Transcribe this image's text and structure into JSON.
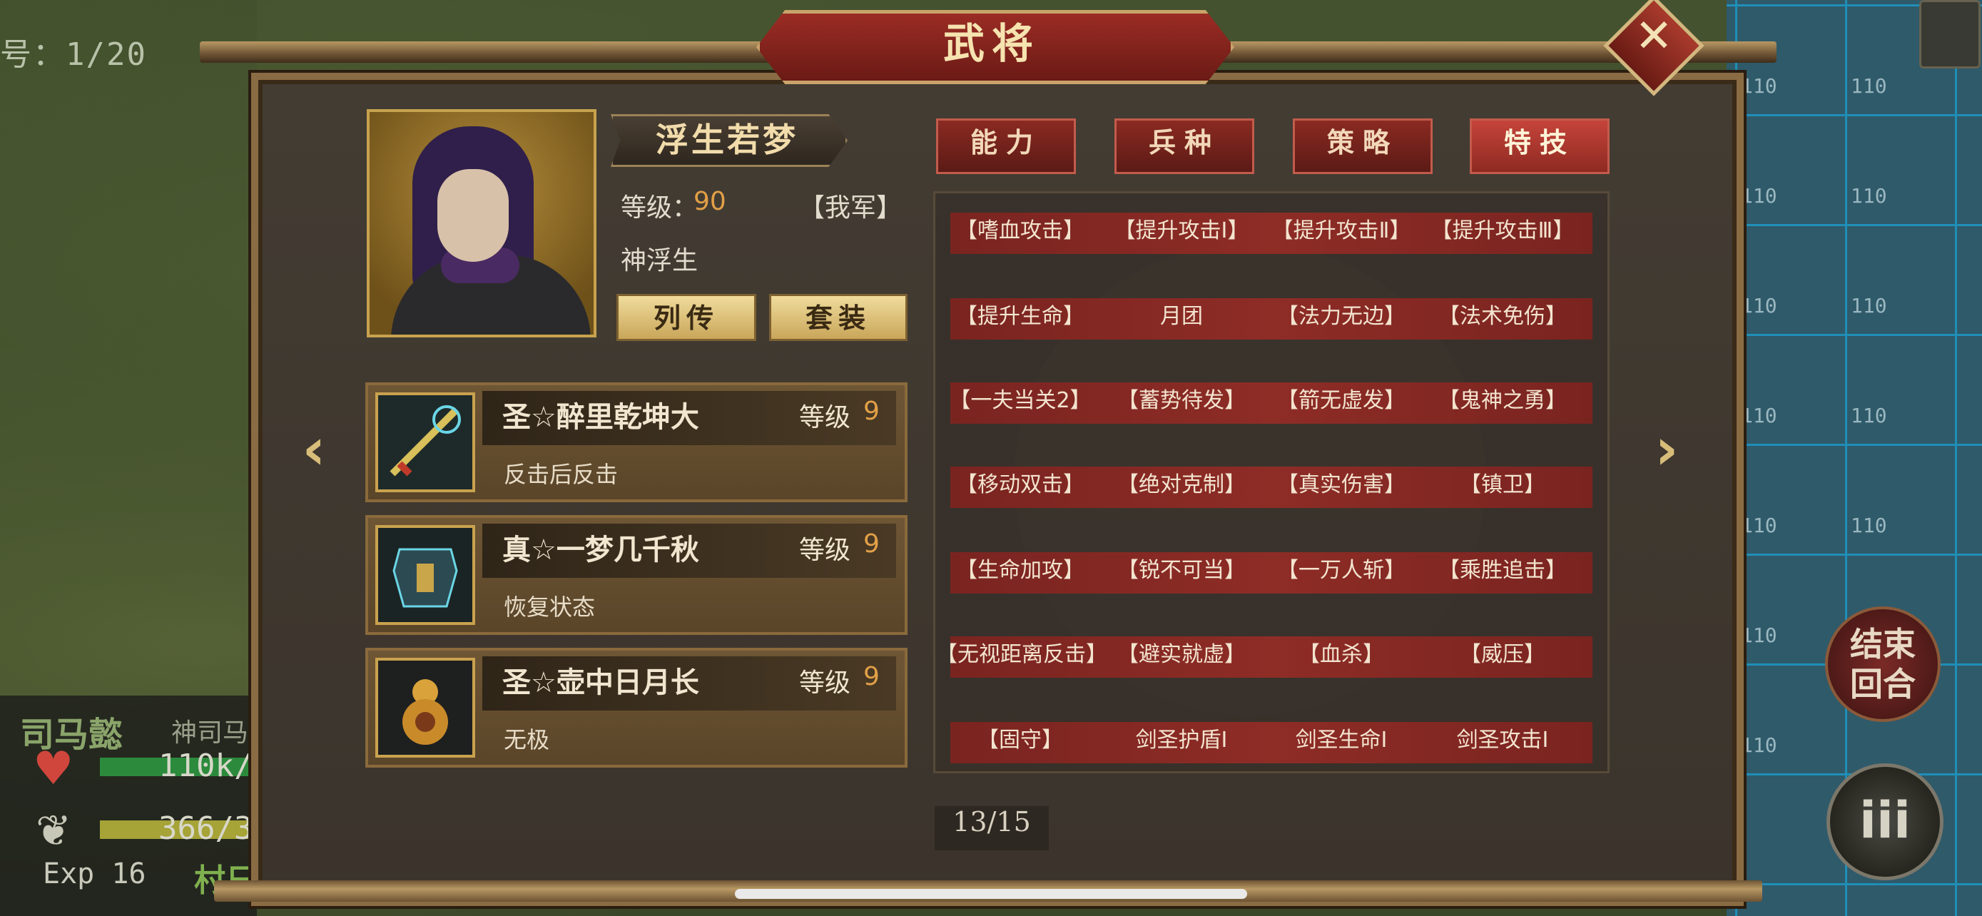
{
  "map": {
    "counter": "号：1/20",
    "grid_number": "110",
    "unit": {
      "name": "司马懿",
      "title": "神司马",
      "hp": "110k/",
      "mp": "366/3",
      "exp": "Exp 16",
      "location": "村日"
    },
    "end_turn_line1": "结束",
    "end_turn_line2": "回合",
    "menu_glyph": "iii"
  },
  "dialog": {
    "title": "武将",
    "close_glyph": "✕",
    "hero": {
      "name": "浮生若梦",
      "level_label": "等级：",
      "level_value": "90",
      "faction": "【我军】",
      "title": "神浮生",
      "btn_biography": "列传",
      "btn_set": "套装"
    },
    "items": [
      {
        "name": "圣☆醉里乾坤大",
        "level_label": "等级",
        "level": "9",
        "desc": "反击后反击",
        "badge": "圣"
      },
      {
        "name": "真☆一梦几千秋",
        "level_label": "等级",
        "level": "9",
        "desc": "恢复状态",
        "badge": ""
      },
      {
        "name": "圣☆壶中日月长",
        "level_label": "等级",
        "level": "9",
        "desc": "无极",
        "badge": "圣"
      }
    ],
    "tabs": [
      "能力",
      "兵种",
      "策略",
      "特技"
    ],
    "active_tab": "特技",
    "skills": [
      [
        "【嗜血攻击】",
        "【提升攻击Ⅰ】",
        "【提升攻击Ⅱ】",
        "【提升攻击Ⅲ】"
      ],
      [
        "【提升生命】",
        "月团",
        "【法力无边】",
        "【法术免伤】"
      ],
      [
        "【一夫当关2】",
        "【蓄势待发】",
        "【箭无虚发】",
        "【鬼神之勇】"
      ],
      [
        "【移动双击】",
        "【绝对克制】",
        "【真实伤害】",
        "【镇卫】"
      ],
      [
        "【生命加攻】",
        "【锐不可当】",
        "【一万人斩】",
        "【乘胜追击】"
      ],
      [
        "【无视距离反击】",
        "【避实就虚】",
        "【血杀】",
        "【威压】"
      ],
      [
        "【固守】",
        "剑圣护盾Ⅰ",
        "剑圣生命Ⅰ",
        "剑圣攻击Ⅰ"
      ]
    ],
    "pager": "13/15",
    "arrow_left": "‹",
    "arrow_right": "›"
  },
  "colors": {
    "accent_gold": "#c9a65a",
    "tab_red": "#8a2a22",
    "level_orange": "#e3a047"
  }
}
